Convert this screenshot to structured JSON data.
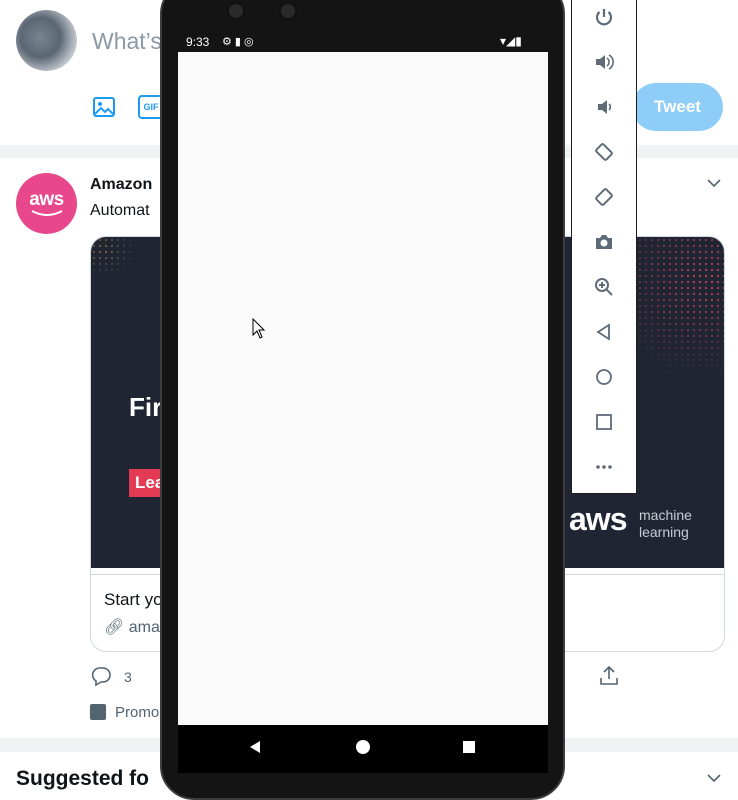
{
  "compose": {
    "placeholder": "What’s",
    "tweet_button": "Tweet"
  },
  "tweet": {
    "author": "Amazon",
    "text": "Automat",
    "card": {
      "headline": "Fir",
      "cta": "Lea",
      "brand": "aws",
      "brand_sub1": "machine",
      "brand_sub2": "learning",
      "description": "Start yo",
      "link": "ama"
    },
    "reply_count": "3",
    "promoted": "Promo"
  },
  "suggested": "Suggested fo",
  "emulator": {
    "status_time": "9:33",
    "status_icons": "⚙ ▮ ◎",
    "status_right": "▾◢▮",
    "toolbar_items": [
      "power-icon",
      "volume-up-icon",
      "volume-down-icon",
      "rotate-left-icon",
      "rotate-right-icon",
      "camera-icon",
      "zoom-icon",
      "back-icon",
      "home-icon",
      "overview-icon",
      "more-icon"
    ]
  },
  "colors": {
    "twitter_blue": "#1d9bf0",
    "tweet_button_disabled": "#8ecdf8",
    "aws_pink": "#e8478b",
    "card_dark": "#1f2532",
    "cta_red": "#e23b53"
  }
}
